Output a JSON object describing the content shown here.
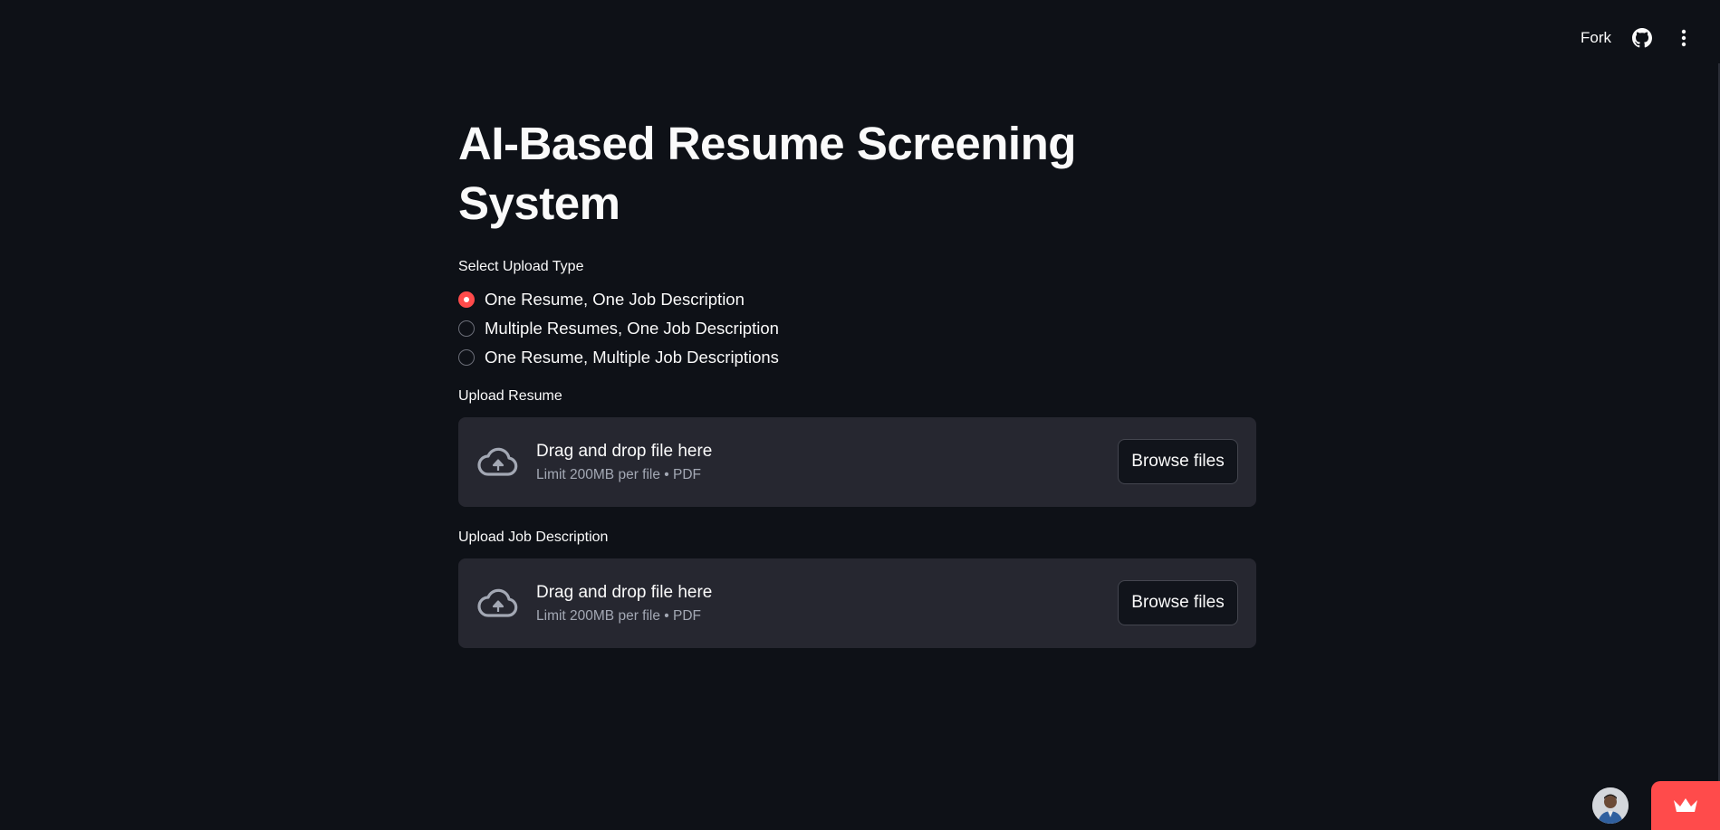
{
  "toolbar": {
    "fork_label": "Fork",
    "github_icon": "github-icon",
    "menu_icon": "kebab-menu-icon"
  },
  "main": {
    "title": "AI-Based Resume Screening System",
    "upload_type": {
      "label": "Select Upload Type",
      "options": [
        {
          "label": "One Resume, One Job Description",
          "selected": true
        },
        {
          "label": "Multiple Resumes, One Job Description",
          "selected": false
        },
        {
          "label": "One Resume, Multiple Job Descriptions",
          "selected": false
        }
      ]
    },
    "uploaders": [
      {
        "label": "Upload Resume",
        "drop_text": "Drag and drop file here",
        "limit_text": "Limit 200MB per file • PDF",
        "button_label": "Browse files",
        "icon": "cloud-upload-icon"
      },
      {
        "label": "Upload Job Description",
        "drop_text": "Drag and drop file here",
        "limit_text": "Limit 200MB per file • PDF",
        "button_label": "Browse files",
        "icon": "cloud-upload-icon"
      }
    ]
  },
  "footer": {
    "avatar_icon": "user-avatar",
    "badge_icon": "crown-icon"
  },
  "colors": {
    "background": "#0e1117",
    "surface": "#262730",
    "accent": "#ff4b4b",
    "text": "#fafafa",
    "muted_text": "#a3a8b4"
  }
}
